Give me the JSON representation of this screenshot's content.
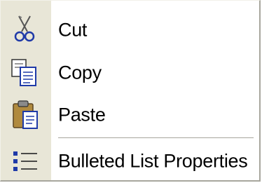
{
  "context_menu": {
    "items": [
      {
        "label": "Cut",
        "icon": "scissors-icon"
      },
      {
        "label": "Copy",
        "icon": "copy-icon"
      },
      {
        "label": "Paste",
        "icon": "paste-icon"
      },
      {
        "label": "Bulleted List Properties",
        "icon": "bulleted-list-icon"
      }
    ]
  },
  "colors": {
    "gutter": "#e8e6d7",
    "menu_background": "#ffffff",
    "border_shadow": "#a7a69d",
    "icon_blue": "#1f3aa8"
  }
}
